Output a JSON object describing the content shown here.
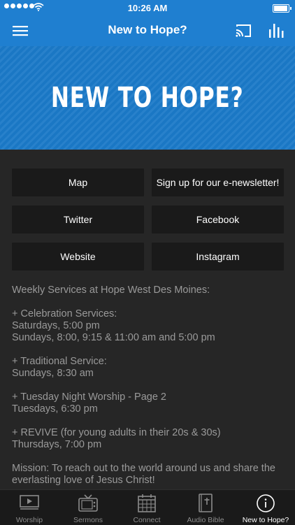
{
  "status_bar": {
    "time": "10:26 AM"
  },
  "nav": {
    "title": "New to Hope?"
  },
  "hero": {
    "heading": "NEW TO HOPE?"
  },
  "links": {
    "map": "Map",
    "newsletter": "Sign up for our e-newsletter!",
    "twitter": "Twitter",
    "facebook": "Facebook",
    "website": "Website",
    "instagram": "Instagram"
  },
  "info": {
    "intro": "Weekly Services at Hope West Des Moines:",
    "celebration_title": "+ Celebration Services:",
    "celebration_sat": "Saturdays, 5:00 pm",
    "celebration_sun": "Sundays, 8:00, 9:15 & 11:00 am and 5:00 pm",
    "traditional_title": "+ Traditional Service:",
    "traditional_time": "Sundays, 8:30 am",
    "tuesday_title": "+ Tuesday Night Worship - Page 2",
    "tuesday_time": "Tuesdays, 6:30 pm",
    "revive_title": "+ REVIVE (for young adults in their 20s & 30s)",
    "revive_time": "Thursdays, 7:00 pm",
    "mission": "Mission: To reach out to the world around us and share the everlasting love of Jesus Christ!"
  },
  "tabs": [
    {
      "label": "Worship",
      "icon": "play-icon"
    },
    {
      "label": "Sermons",
      "icon": "tv-icon"
    },
    {
      "label": "Connect",
      "icon": "calendar-icon"
    },
    {
      "label": "Audio Bible",
      "icon": "bible-icon"
    },
    {
      "label": "New to Hope?",
      "icon": "info-icon",
      "active": true
    }
  ],
  "colors": {
    "accent": "#1f7fd0",
    "background": "#262626",
    "button": "#1a1a1a",
    "text_muted": "#9a9a9a"
  }
}
